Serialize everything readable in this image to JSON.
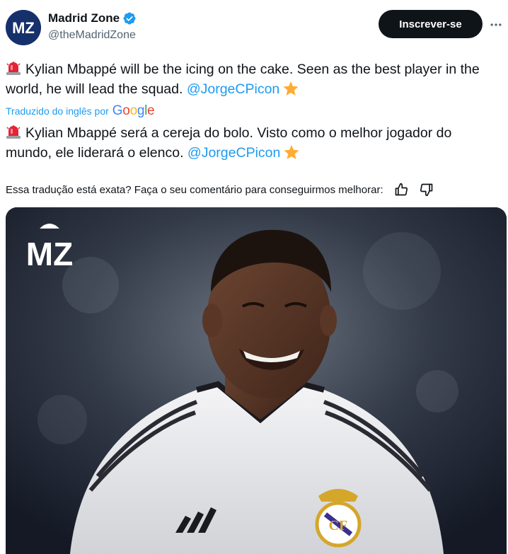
{
  "author": {
    "display_name": "Madrid Zone",
    "handle": "@theMadridZone",
    "verified": true,
    "avatar_text": "MZ"
  },
  "actions": {
    "follow_label": "Inscrever-se",
    "more_icon": "more-horizontal-icon"
  },
  "tweet": {
    "original_text_before": "Kylian Mbappé will be the icing on the cake. Seen as the best player in the world, he will lead the squad.",
    "original_mention": "@JorgeCPicon",
    "translated_by": "Traduzido do inglês por",
    "translator_brand": "Google",
    "translated_text_before": "Kylian Mbappé será a cereja do bolo. Visto como o melhor jogador do mundo, ele liderará o elenco.",
    "translated_mention": "@JorgeCPicon"
  },
  "feedback": {
    "question": "Essa tradução está exata? Faça o seu comentário para conseguirmos melhorar:",
    "thumbs_up_icon": "thumbs-up-icon",
    "thumbs_down_icon": "thumbs-down-icon"
  },
  "media": {
    "watermark": "MZ",
    "description_icon": "player-photo"
  },
  "colors": {
    "link": "#1d9bf0",
    "text": "#0f1419",
    "muted": "#536471",
    "button_bg": "#0f1419"
  }
}
